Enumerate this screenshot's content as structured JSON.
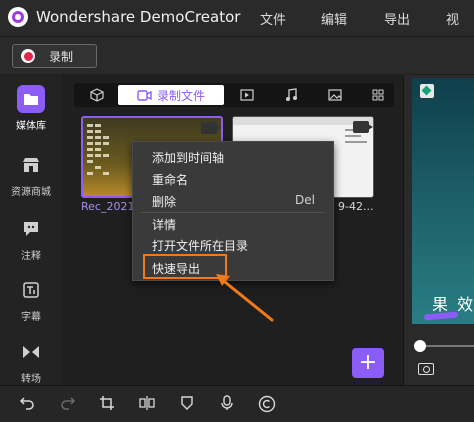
{
  "app": {
    "title": "Wondershare DemoCreator",
    "menu": [
      "文件",
      "编辑",
      "导出",
      "视"
    ]
  },
  "record": {
    "label": "录制"
  },
  "sidebar": {
    "items": [
      {
        "label": "媒体库",
        "icon": "folder-icon",
        "active": true
      },
      {
        "label": "资源商城",
        "icon": "store-icon",
        "active": false
      },
      {
        "label": "注释",
        "icon": "annotation-icon",
        "active": false
      },
      {
        "label": "字幕",
        "icon": "caption-icon",
        "active": false
      },
      {
        "label": "转场",
        "icon": "transition-icon",
        "active": false
      }
    ]
  },
  "media": {
    "tabs": [
      {
        "icon": "cube-icon",
        "label": ""
      },
      {
        "icon": "video-icon",
        "label": "录制文件",
        "active": true
      },
      {
        "icon": "play-icon",
        "label": ""
      },
      {
        "icon": "music-icon",
        "label": ""
      },
      {
        "icon": "image-icon",
        "label": ""
      },
      {
        "icon": "grid-icon",
        "label": ""
      }
    ],
    "thumbnails": [
      {
        "name": "Rec_2021"
      },
      {
        "name": "9-42..."
      }
    ]
  },
  "context_menu": {
    "items": [
      {
        "label": "添加到时间轴"
      },
      {
        "label": "重命名"
      },
      {
        "label": "删除",
        "shortcut": "Del"
      },
      {
        "label": "详情"
      },
      {
        "label": "打开文件所在目录"
      },
      {
        "label": "快速导出",
        "highlighted": true
      }
    ]
  },
  "preview": {
    "caption": "果 效"
  },
  "colors": {
    "accent": "#8b5cf6",
    "record_red": "#e0294a",
    "highlight_orange": "#f07a1a"
  },
  "toolbar": {
    "tools": [
      "undo-icon",
      "redo-icon",
      "crop-icon",
      "split-icon",
      "mask-icon",
      "mic-icon",
      "copyright-icon"
    ]
  }
}
